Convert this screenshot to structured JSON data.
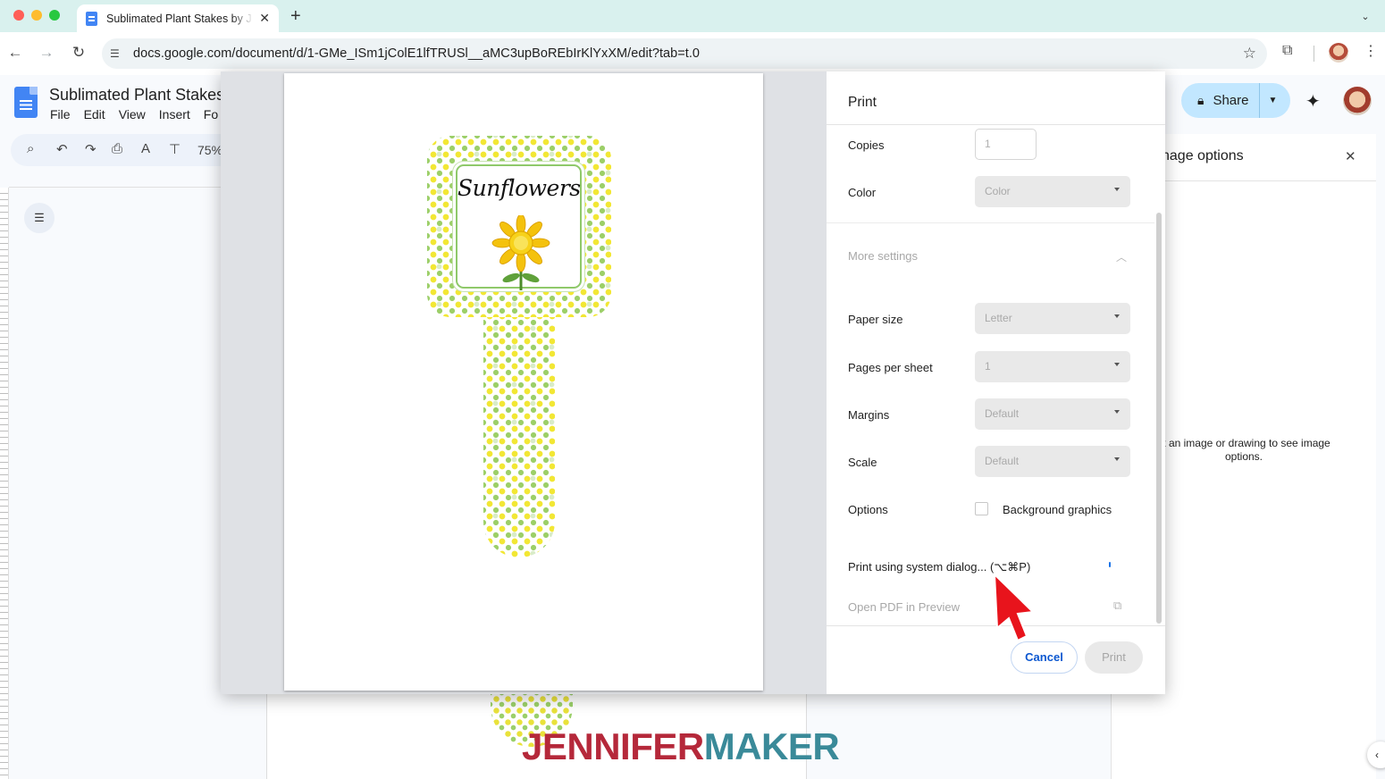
{
  "browser": {
    "tab_title": "Sublimated Plant Stakes by J",
    "url": "docs.google.com/document/d/1-GMe_ISm1jColE1lfTRUSl__aMC3upBoREbIrKlYxXM/edit?tab=t.0"
  },
  "docs": {
    "title": "Sublimated Plant Stakes",
    "menu": [
      "File",
      "Edit",
      "View",
      "Insert",
      "Fo"
    ],
    "zoom": "75%",
    "share_label": "Share",
    "side_panel": {
      "title": "nage options",
      "hint": "ct an image or drawing to see image options."
    }
  },
  "print_dialog": {
    "title": "Print",
    "preview": {
      "label_text": "Sunflowers"
    },
    "copies": {
      "label": "Copies",
      "value": "1"
    },
    "color": {
      "label": "Color",
      "value": "Color"
    },
    "more_settings": "More settings",
    "paper_size": {
      "label": "Paper size",
      "value": "Letter"
    },
    "pages_per_sheet": {
      "label": "Pages per sheet",
      "value": "1"
    },
    "margins": {
      "label": "Margins",
      "value": "Default"
    },
    "scale": {
      "label": "Scale",
      "value": "Default"
    },
    "options": {
      "label": "Options",
      "background_graphics": "Background graphics",
      "checked": false
    },
    "system_dialog": "Print using system dialog... (⌥⌘P)",
    "open_pdf": "Open PDF in Preview",
    "cancel": "Cancel",
    "print": "Print"
  },
  "watermark": {
    "part1": "JENNIFER",
    "part2": "MAKER"
  },
  "colors": {
    "accent_blue": "#0b57d0",
    "share_bg": "#c2e7ff",
    "arrow_red": "#e8141c",
    "wm_red": "#b5283a",
    "wm_teal": "#3a8a99"
  },
  "icons": [
    "back-arrow-icon",
    "forward-arrow-icon",
    "reload-icon",
    "site-info-icon",
    "star-icon",
    "extensions-icon",
    "kebab-menu-icon",
    "lock-icon",
    "gemini-icon",
    "close-icon",
    "external-link-icon"
  ]
}
